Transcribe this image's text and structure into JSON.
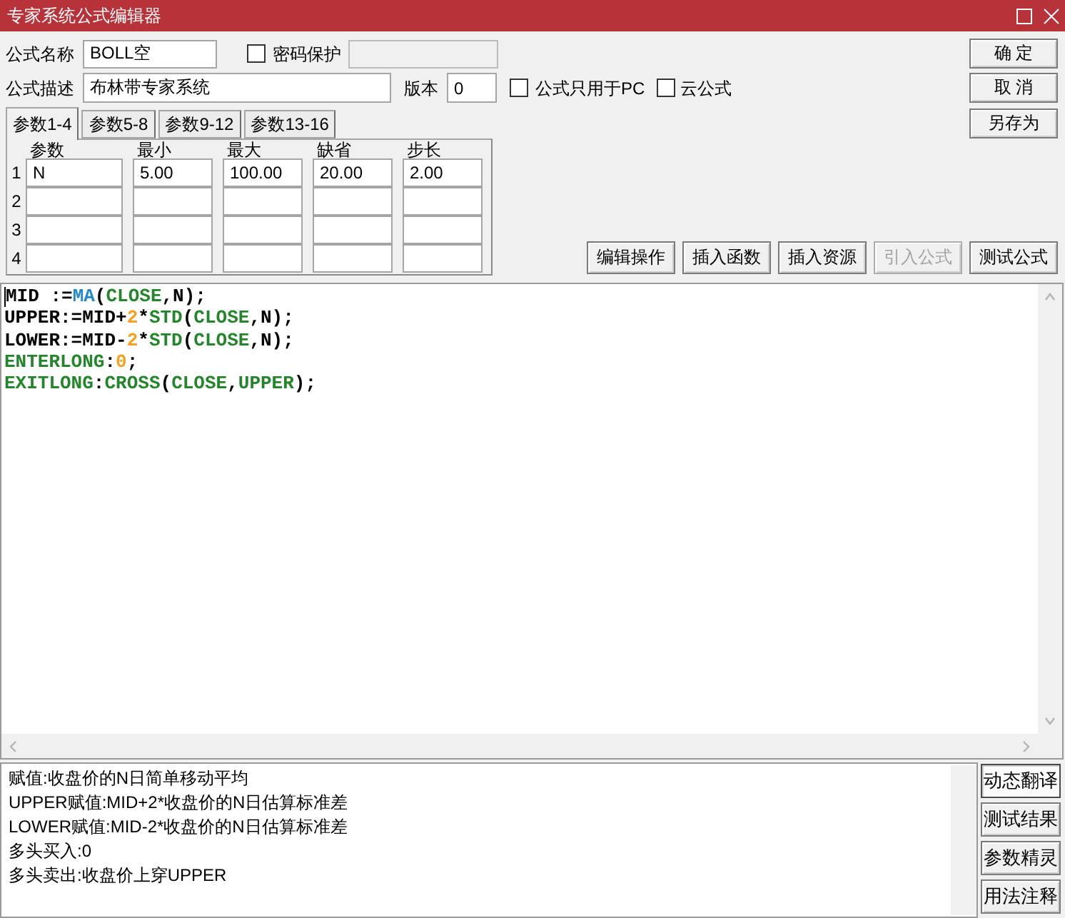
{
  "window": {
    "title": "专家系统公式编辑器"
  },
  "formula": {
    "name_label": "公式名称",
    "name": "BOLL空",
    "password": {
      "label": "密码保护",
      "checked": false
    },
    "password_field": {
      "disabled": true
    },
    "description_label": "公式描述",
    "description": "布林带专家系统",
    "version_label": "版本",
    "version": "0",
    "options": [
      {
        "label": "公式只用于PC",
        "checked": false
      },
      {
        "label": "云公式",
        "checked": false
      }
    ]
  },
  "dialog_buttons": [
    "确 定",
    "取 消",
    "另存为"
  ],
  "param_tabs": [
    {
      "label": "参数1-4",
      "selected": true
    },
    {
      "label": "参数5-8",
      "selected": false
    },
    {
      "label": "参数9-12",
      "selected": false
    },
    {
      "label": "参数13-16",
      "selected": false
    }
  ],
  "params": {
    "columns": [
      "参数",
      "最小",
      "最大",
      "缺省",
      "步长"
    ],
    "rows": [
      {
        "number": "1",
        "cells": [
          "N",
          "5.00",
          "100.00",
          "20.00",
          "2.00"
        ]
      },
      {
        "number": "2"
      },
      {
        "number": "3"
      },
      {
        "number": "4"
      }
    ]
  },
  "action_buttons": [
    {
      "label": "编辑操作",
      "disabled": false
    },
    {
      "label": "插入函数",
      "disabled": false
    },
    {
      "label": "插入资源",
      "disabled": false
    },
    {
      "label": "引入公式",
      "disabled": true
    },
    {
      "label": "测试公式",
      "disabled": false
    }
  ],
  "code_lines": [
    {
      "tokens": [
        {
          "text": "MID :=",
          "kind": "plain"
        },
        {
          "text": "MA",
          "kind": "function"
        },
        {
          "text": "(",
          "kind": "plain"
        },
        {
          "text": "CLOSE",
          "kind": "keyword"
        },
        {
          "text": ",N);",
          "kind": "plain"
        }
      ]
    },
    {
      "tokens": [
        {
          "text": "UPPER:=MID+",
          "kind": "plain"
        },
        {
          "text": "2",
          "kind": "number"
        },
        {
          "text": "*",
          "kind": "plain"
        },
        {
          "text": "STD",
          "kind": "keyword"
        },
        {
          "text": "(",
          "kind": "plain"
        },
        {
          "text": "CLOSE",
          "kind": "keyword"
        },
        {
          "text": ",N);",
          "kind": "plain"
        }
      ]
    },
    {
      "tokens": [
        {
          "text": "LOWER:=MID-",
          "kind": "plain"
        },
        {
          "text": "2",
          "kind": "number"
        },
        {
          "text": "*",
          "kind": "plain"
        },
        {
          "text": "STD",
          "kind": "keyword"
        },
        {
          "text": "(",
          "kind": "plain"
        },
        {
          "text": "CLOSE",
          "kind": "keyword"
        },
        {
          "text": ",N);",
          "kind": "plain"
        }
      ]
    },
    {
      "tokens": [
        {
          "text": "ENTERLONG",
          "kind": "keyword"
        },
        {
          "text": ":",
          "kind": "plain"
        },
        {
          "text": "0",
          "kind": "number"
        },
        {
          "text": ";",
          "kind": "plain"
        }
      ]
    },
    {
      "tokens": [
        {
          "text": "EXITLONG",
          "kind": "keyword"
        },
        {
          "text": ":",
          "kind": "plain"
        },
        {
          "text": "CROSS",
          "kind": "keyword"
        },
        {
          "text": "(",
          "kind": "plain"
        },
        {
          "text": "CLOSE",
          "kind": "keyword"
        },
        {
          "text": ",",
          "kind": "plain"
        },
        {
          "text": "UPPER",
          "kind": "keyword"
        },
        {
          "text": ");",
          "kind": "plain"
        }
      ]
    }
  ],
  "translation_lines": [
    "赋值:收盘价的N日简单移动平均",
    "UPPER赋值:MID+2*收盘价的N日估算标准差",
    "LOWER赋值:MID-2*收盘价的N日估算标准差",
    "多头买入:0",
    "多头卖出:收盘价上穿UPPER"
  ],
  "side_buttons": [
    {
      "label": "动态翻译",
      "selected": true
    },
    {
      "label": "测试结果",
      "selected": false
    },
    {
      "label": "参数精灵",
      "selected": false
    },
    {
      "label": "用法注释",
      "selected": false
    }
  ]
}
